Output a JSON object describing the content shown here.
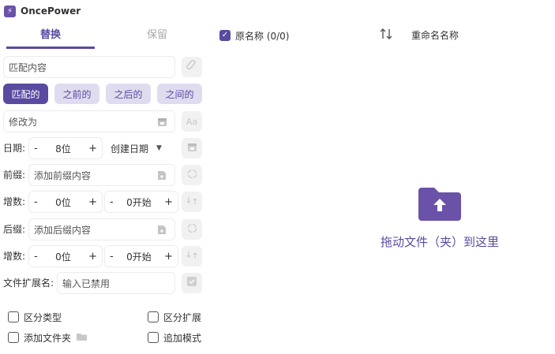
{
  "app": {
    "title": "OncePower",
    "logo_glyph": "⚡"
  },
  "tabs": [
    {
      "label": "替换"
    },
    {
      "label": "保留"
    }
  ],
  "match": {
    "placeholder": "匹配内容"
  },
  "modes": [
    {
      "label": "匹配的"
    },
    {
      "label": "之前的"
    },
    {
      "label": "之后的"
    },
    {
      "label": "之间的"
    }
  ],
  "modify": {
    "placeholder": "修改为",
    "case_icon_text": "Aa"
  },
  "date": {
    "label": "日期:",
    "minus": "-",
    "plus": "+",
    "value": "8位",
    "type": "创建日期"
  },
  "prefix": {
    "label": "前缀:",
    "placeholder": "添加前缀内容"
  },
  "prefix_increment": {
    "label": "增数:",
    "digits": "0位",
    "start": "0开始",
    "minus": "-",
    "plus": "+"
  },
  "suffix": {
    "label": "后缀:",
    "placeholder": "添加后缀内容"
  },
  "suffix_increment": {
    "label": "增数:",
    "digits": "0位",
    "start": "0开始",
    "minus": "-",
    "plus": "+"
  },
  "extension": {
    "label": "文件扩展名:",
    "placeholder": "输入已禁用"
  },
  "options": {
    "distinguish_type": "区分类型",
    "distinguish_ext": "区分扩展",
    "add_folder": "添加文件夹",
    "append_mode": "追加模式"
  },
  "file_list": {
    "original_name": "原名称 (0/0)",
    "rename_name": "重命名名称"
  },
  "drop": {
    "text": "拖动文件（夹）到这里"
  },
  "colors": {
    "accent": "#5a4aa0",
    "accent_light": "#e0dcf0",
    "folder": "#6a52a8"
  }
}
